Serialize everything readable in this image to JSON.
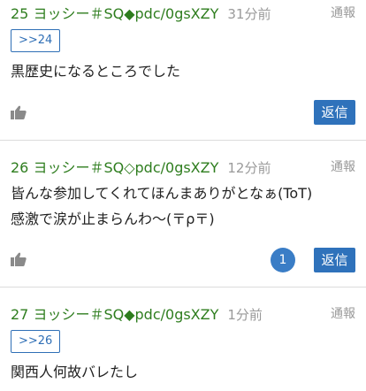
{
  "posts": [
    {
      "number": "25",
      "author": "ヨッシー＃SQ◆pdc/0gsXZY",
      "time": "31分前",
      "report_label": "通報",
      "anchor": ">>24",
      "lines": [
        "黒歴史になるところでした"
      ],
      "reply_label": "返信"
    },
    {
      "number": "26",
      "author": "ヨッシー＃SQ◇pdc/0gsXZY",
      "time": "12分前",
      "report_label": "通報",
      "lines": [
        "皆んな参加してくれてほんまありがとなぁ(ToT)",
        "感激で涙が止まらんわ〜(〒ρ〒)"
      ],
      "reply_count": "1",
      "reply_label": "返信"
    },
    {
      "number": "27",
      "author": "ヨッシー＃SQ◆pdc/0gsXZY",
      "time": "1分前",
      "report_label": "通報",
      "anchor": ">>26",
      "lines": [
        "関西人何故バレたし"
      ]
    }
  ],
  "icons": {
    "like": "thumbs-up-icon"
  },
  "colors": {
    "author": "#2e7d1e",
    "accent": "#2f72bb",
    "muted": "#9a9a9a",
    "divider": "#dcdcdc"
  }
}
